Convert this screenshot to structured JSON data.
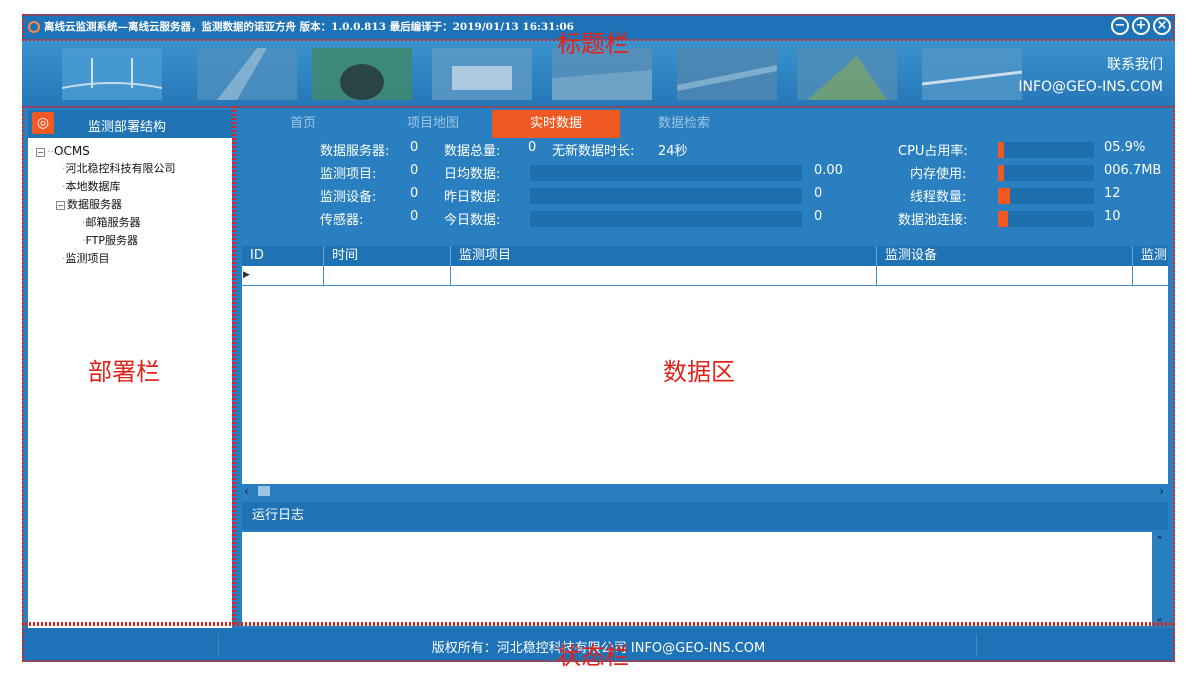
{
  "titlebar": {
    "title": "离线云监测系统—离线云服务器，监测数据的诺亚方舟  版本：1.0.0.813  最后编译于：2019/01/13 16:31:06",
    "btn_min": "−",
    "btn_max": "+",
    "btn_close": "×"
  },
  "banner": {
    "contact_label": "联系我们",
    "contact_email": "INFO@GEO-INS.COM"
  },
  "sidebar": {
    "title": "监测部署结构",
    "tree": [
      "OCMS",
      "河北稳控科技有限公司",
      "本地数据库",
      "数据服务器",
      "邮箱服务器",
      "FTP服务器",
      "监测项目"
    ]
  },
  "tabs": [
    "首页",
    "项目地图",
    "实时数据",
    "数据检索"
  ],
  "active_tab": "实时数据",
  "stats": {
    "data_server_label": "数据服务器:",
    "data_server_val": "0",
    "monitor_item_label": "监测项目:",
    "monitor_item_val": "0",
    "monitor_device_label": "监测设备:",
    "monitor_device_val": "0",
    "sensor_label": "传感器:",
    "sensor_val": "0",
    "total_label": "数据总量:",
    "total_val": "0",
    "no_new_label": "无新数据时长:",
    "no_new_val": "24秒",
    "daily_avg_label": "日均数据:",
    "daily_avg_val": "0.00",
    "yesterday_label": "昨日数据:",
    "yesterday_val": "0",
    "today_label": "今日数据:",
    "today_val": "0",
    "cpu_label": "CPU占用率:",
    "cpu_val": "05.9%",
    "cpu_level": 0.059,
    "mem_label": "内存使用:",
    "mem_val": "006.7MB",
    "mem_level": 0.01,
    "thread_label": "线程数量:",
    "thread_val": "12",
    "thread_level": 0.12,
    "pool_label": "数据池连接:",
    "pool_val": "10",
    "pool_level": 0.1
  },
  "grid": {
    "columns": [
      "ID",
      "时间",
      "监测项目",
      "监测设备",
      "监测"
    ]
  },
  "log": {
    "title": "运行日志"
  },
  "statusbar": {
    "text": "版权所有：河北稳控科技有限公司 INFO@GEO-INS.COM"
  },
  "annotations": {
    "title_bar": "标题栏",
    "sidebar": "部署栏",
    "data_area": "数据区",
    "status_bar": "状态栏"
  },
  "colors": {
    "accent": "#f05a22",
    "primary": "#2a7fc0",
    "annotation": "#e2231a"
  }
}
